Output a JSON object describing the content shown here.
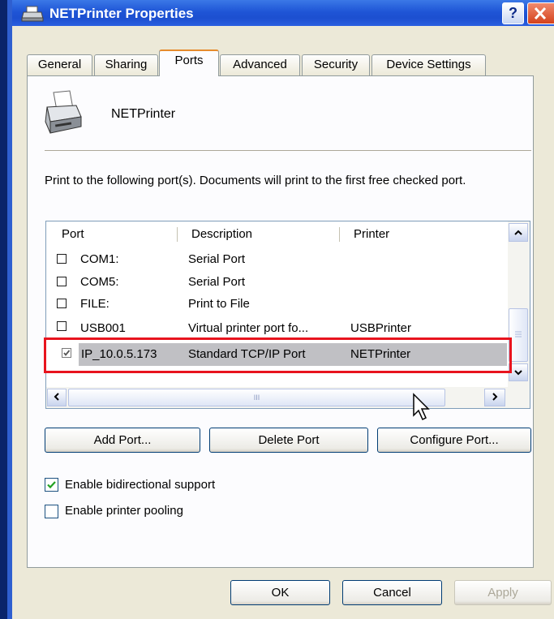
{
  "window": {
    "title": "NETPrinter Properties"
  },
  "tabs": [
    "General",
    "Sharing",
    "Ports",
    "Advanced",
    "Security",
    "Device Settings"
  ],
  "active_tab": "Ports",
  "printer_name": "NETPrinter",
  "instructions": "Print to the following port(s). Documents will print to the first free checked port.",
  "port_list": {
    "columns": [
      "Port",
      "Description",
      "Printer"
    ],
    "rows": [
      {
        "checked": false,
        "port": "COM1:",
        "description": "Serial Port",
        "printer": ""
      },
      {
        "checked": false,
        "port": "COM5:",
        "description": "Serial Port",
        "printer": ""
      },
      {
        "checked": false,
        "port": "FILE:",
        "description": "Print to File",
        "printer": ""
      },
      {
        "checked": false,
        "port": "USB001",
        "description": "Virtual printer port fo...",
        "printer": "USBPrinter"
      },
      {
        "checked": true,
        "port": "IP_10.0.5.173",
        "description": "Standard TCP/IP Port",
        "printer": "NETPrinter",
        "selected": true
      }
    ]
  },
  "port_buttons": {
    "add": "Add Port...",
    "delete": "Delete Port",
    "configure": "Configure Port..."
  },
  "options": {
    "bidirectional": {
      "label": "Enable bidirectional support",
      "checked": true
    },
    "pooling": {
      "label": "Enable printer pooling",
      "checked": false
    }
  },
  "dialog_buttons": {
    "ok": "OK",
    "cancel": "Cancel",
    "apply": "Apply"
  },
  "scroll_thumb_grip": "III",
  "colors": {
    "titlebar": "#1f55d6",
    "highlight": "#e8141e",
    "selected_row": "#c0c0c4",
    "active_tab_accent": "#e68b2c"
  }
}
